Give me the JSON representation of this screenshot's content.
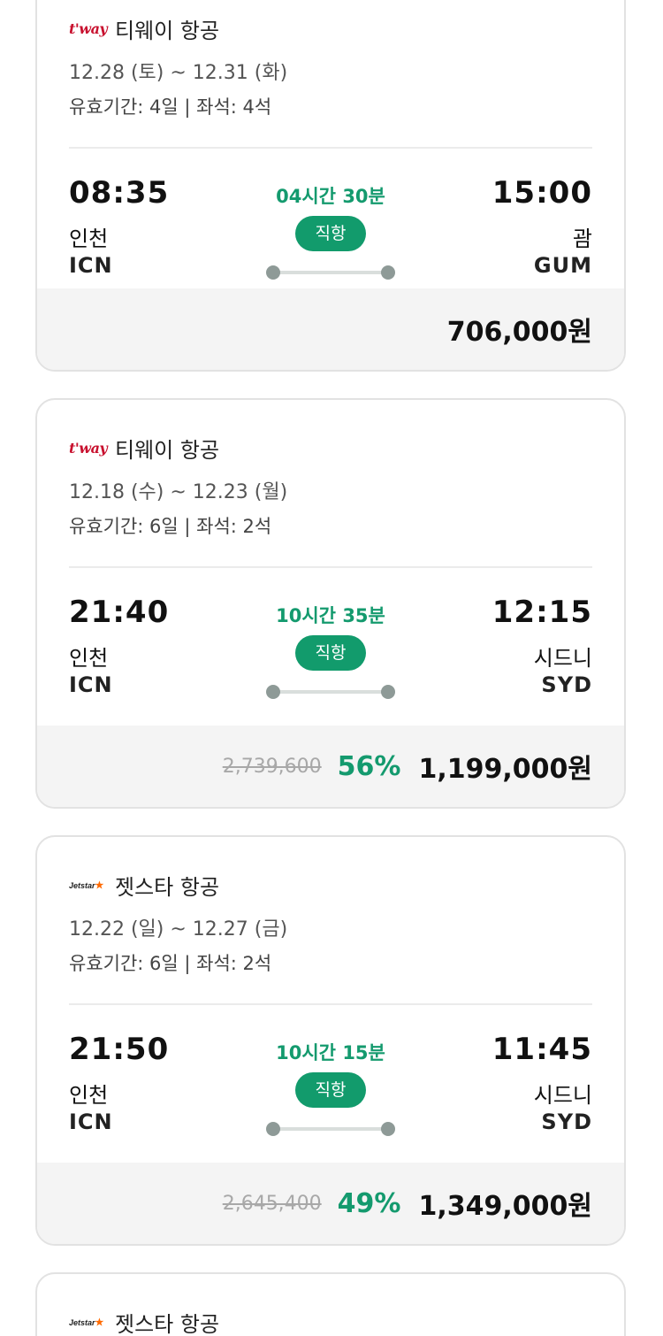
{
  "flights": [
    {
      "airline_logo_text": "t'way",
      "airline_name": "티웨이 항공",
      "dates": "12.28 (토) ~ 12.31 (화)",
      "validity": "유효기간: 4일 | 좌석: 4석",
      "dep_time": "08:35",
      "dep_city": "인천",
      "dep_code": "ICN",
      "duration": "04시간 30분",
      "direct": "직항",
      "arr_time": "15:00",
      "arr_city": "괌",
      "arr_code": "GUM",
      "original_price": "",
      "discount": "",
      "price": "706,000원"
    },
    {
      "airline_logo_text": "t'way",
      "airline_name": "티웨이 항공",
      "dates": "12.18 (수) ~ 12.23 (월)",
      "validity": "유효기간: 6일 | 좌석: 2석",
      "dep_time": "21:40",
      "dep_city": "인천",
      "dep_code": "ICN",
      "duration": "10시간 35분",
      "direct": "직항",
      "arr_time": "12:15",
      "arr_city": "시드니",
      "arr_code": "SYD",
      "original_price": "2,739,600",
      "discount": "56%",
      "price": "1,199,000원"
    },
    {
      "airline_logo_text": "Jetstar",
      "airline_name": "젯스타 항공",
      "dates": "12.22 (일) ~ 12.27 (금)",
      "validity": "유효기간: 6일 | 좌석: 2석",
      "dep_time": "21:50",
      "dep_city": "인천",
      "dep_code": "ICN",
      "duration": "10시간 15분",
      "direct": "직항",
      "arr_time": "11:45",
      "arr_city": "시드니",
      "arr_code": "SYD",
      "original_price": "2,645,400",
      "discount": "49%",
      "price": "1,349,000원"
    },
    {
      "airline_logo_text": "Jetstar",
      "airline_name": "젯스타 항공"
    }
  ],
  "colors": {
    "accent_green": "#129b6c",
    "price_background": "#f4f4f4",
    "tway_red": "#c8102e",
    "jetstar_orange": "#ff6a00"
  }
}
